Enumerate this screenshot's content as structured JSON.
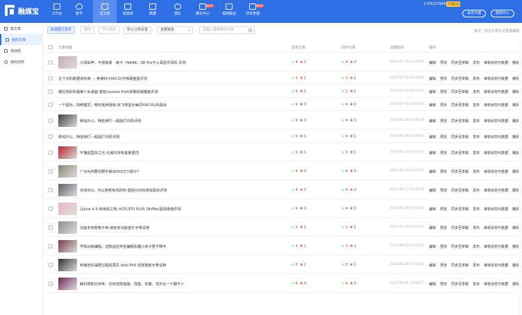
{
  "header": {
    "brand": "融媒宝",
    "nav": [
      {
        "label": "工作台",
        "icon": "home-icon"
      },
      {
        "label": "账号",
        "icon": "account-icon"
      },
      {
        "label": "发文章",
        "icon": "article-icon",
        "active": true
      },
      {
        "label": "发视频",
        "icon": "video-icon"
      },
      {
        "label": "数据",
        "icon": "chart-icon"
      },
      {
        "label": "团队",
        "icon": "team-icon"
      },
      {
        "label": "爆文中心",
        "icon": "fire-icon",
        "badge": "NEW"
      },
      {
        "label": "视频搬运",
        "icon": "transport-icon"
      },
      {
        "label": "评论管理",
        "icon": "comment-icon",
        "badge": "NEW"
      }
    ],
    "phone": "17092279405",
    "vip": "开通会员",
    "btn_vip": "会员代理",
    "btn_help": "帮助中心"
  },
  "sidebar": {
    "items": [
      {
        "label": "发文章",
        "active": false
      },
      {
        "label": "我的文章",
        "active": true
      },
      {
        "label": "发动态",
        "active": false
      },
      {
        "label": "我的动态",
        "active": false
      }
    ]
  },
  "toolbar": {
    "new_article": "新建图文发布",
    "delete": "删除",
    "export": "导出数据",
    "default_cat": "默认分类设置",
    "status_select": "全部状态",
    "search_placeholder": "请输入要搜索的文章",
    "tip": "提示：双击文章可以直接编辑"
  },
  "table": {
    "headers": {
      "title": "文章标题",
      "publish": "发布记录",
      "sync": "同步记录",
      "created": "创建时间",
      "ops": "操作"
    },
    "ops": [
      "编辑",
      "预览",
      "同步至草稿",
      "发布",
      "审核状态与数据",
      "删除"
    ],
    "rows": [
      {
        "title": "只闻其声，不感其累 · 南卡（NANK）OE Pro不入耳蓝牙耳机 评测",
        "pub_ok": "4",
        "pub_err": "0",
        "sync_ok": "4",
        "sync_err": "0",
        "date": "2023-07-15 21:09:52",
        "thumb": true,
        "thumb_color": "#c9a9b6"
      },
      {
        "title": "五寸河的数据资料库 — 奥睿科(ORICO)可移硬盘盒评测",
        "pub_ok": "3",
        "pub_err": "1",
        "sync_ok": "3",
        "sync_err": "1",
        "date": "2023-07-13 06:26:49",
        "thumb": false
      },
      {
        "title": "端拉线彩轮最美少女桌面·雷柏ravemo Pre5承载机械键盘评测",
        "pub_ok": "3",
        "pub_err": "1",
        "sync_ok": "3",
        "sync_err": "1",
        "date": "2023-07-11 10:55:02",
        "thumb": false
      },
      {
        "title": "一个鼠标，四种模式，畅玩各种游戏·双飞燕血手幽灵R90 PLUS鼠标",
        "pub_ok": "4",
        "pub_err": "0",
        "sync_ok": "4",
        "sync_err": "0",
        "date": "2023-07-03 10:43:15",
        "thumb": false
      },
      {
        "title": "移动办公，随走随打—超能打印机评测",
        "pub_ok": "4",
        "pub_err": "0",
        "sync_ok": "4",
        "sync_err": "0",
        "date": "2023-06-30 16:56:03",
        "thumb": true,
        "thumb_color": "#3c3f44"
      },
      {
        "title": "移动办公，随走随打—超能打印机评测",
        "pub_ok": "0",
        "pub_err": "1",
        "sync_ok": "0",
        "sync_err": "1",
        "date": "2023-06-30 16:49:01",
        "thumb": false
      },
      {
        "title": "不愧是国货之光-光威内存条偷量登顶",
        "pub_ok": "3",
        "pub_err": "1",
        "sync_ok": "3",
        "sync_err": "1",
        "date": "2023-06-21 10:12:57",
        "thumb": true,
        "thumb_color": "#b3242b"
      },
      {
        "title": "广州为何要向野外做涂500万只蚊子?",
        "pub_ok": "4",
        "pub_err": "0",
        "sync_ok": "4",
        "sync_err": "0",
        "date": "2023-06-17 21:11:57",
        "thumb": true,
        "thumb_color": "#8b8670"
      },
      {
        "title": "无线402，可以随意有线的快·雷柏V30W游戏鼠标评测",
        "pub_ok": "4",
        "pub_err": "0",
        "sync_ok": "4",
        "sync_err": "0",
        "date": "2023-06-17 15:24:18",
        "thumb": true,
        "thumb_color": "#5e6066"
      },
      {
        "title": "让pcie 4.0 有用武之地-大华C970 PLUS (NVMe)固态硬盘评测",
        "pub_ok": "4",
        "pub_err": "0",
        "sync_ok": "4",
        "sync_err": "0",
        "date": "2023-06-15 11:16:43",
        "thumb": true,
        "thumb_color": "#e8b9bf"
      },
      {
        "title": "功能多到想象不到·纳拓多功能音乐手电试用",
        "pub_ok": "3",
        "pub_err": "1",
        "sync_ok": "3",
        "sync_err": "1",
        "date": "2023-06-13 11:11:17",
        "thumb": true,
        "thumb_color": "#8f8a86"
      },
      {
        "title": "学知识练编程，这款遥控伴侣编程机器人孩子爱不释手",
        "pub_ok": "3",
        "pub_err": "1",
        "sync_ok": "3",
        "sync_err": "1",
        "date": "2023-06-12 14:55:56",
        "thumb": true,
        "thumb_color": "#7a3b4a"
      },
      {
        "title": "和痛苦的减肥过程说再见·dido P50 轻体智能手表试用",
        "pub_ok": "3",
        "pub_err": "1",
        "sync_ok": "3",
        "sync_err": "1",
        "date": "2023-06-06 17:45:46",
        "thumb": true,
        "thumb_color": "#2f3136"
      },
      {
        "title": "解科感影内存条：内存选购指南、性能、容量、性价比一个都不少",
        "pub_ok": "4",
        "pub_err": "0",
        "sync_ok": "4",
        "sync_err": "0",
        "date": "2023-06-06 10:08:27",
        "thumb": true,
        "thumb_color": "#6a2a5a"
      }
    ]
  }
}
